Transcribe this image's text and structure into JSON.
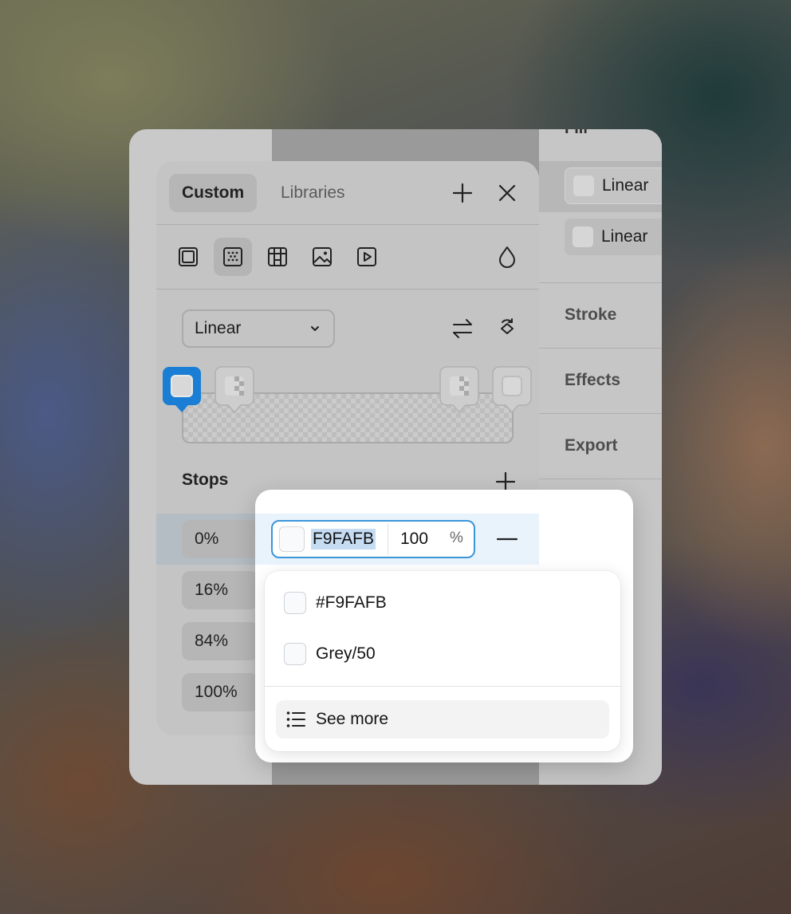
{
  "right_panel": {
    "fill_title": "Fill",
    "fill_items": [
      {
        "label": "Linear"
      },
      {
        "label": "Linear"
      }
    ],
    "sections": [
      "Stroke",
      "Effects",
      "Export"
    ]
  },
  "picker": {
    "tabs": [
      {
        "label": "Custom",
        "active": true
      },
      {
        "label": "Libraries",
        "active": false
      }
    ],
    "header_icons": [
      "plus-icon",
      "close-icon"
    ],
    "fill_types": [
      "solid-fill-icon",
      "gradient-fill-icon",
      "pattern-fill-icon",
      "image-fill-icon",
      "video-fill-icon"
    ],
    "active_fill_type": "gradient-fill-icon",
    "opacity_icon": "droplet-icon",
    "gradient_type": "Linear",
    "gradient_actions": [
      "swap-icon",
      "rotate-icon"
    ],
    "stops_title": "Stops",
    "stops": [
      {
        "position": "0%",
        "selected": true
      },
      {
        "position": "16%"
      },
      {
        "position": "84%"
      },
      {
        "position": "100%"
      }
    ]
  },
  "stop_editor": {
    "hex": "F9FAFB",
    "opacity": "100",
    "unit": "%",
    "swatch_color": "#F9FAFB"
  },
  "suggestions": {
    "items": [
      {
        "label": "#F9FAFB",
        "color": "#F9FAFB"
      },
      {
        "label": "Grey/50",
        "color": "#F9FAFB"
      }
    ],
    "see_more": "See more"
  },
  "colors": {
    "accent": "#3B95D9",
    "selection": "#C5DCF3",
    "row_highlight": "#E9F3FC"
  }
}
